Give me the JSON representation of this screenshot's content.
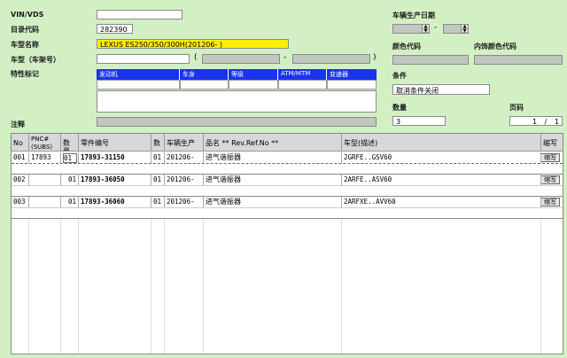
{
  "labels": {
    "vin": "VIN/VDS",
    "catalog_code": "目录代码",
    "model_name": "车型名称",
    "frame_model": "车型（车架号）",
    "features": "特性标记",
    "remarks": "注释",
    "prod_date": "车辆生产日期",
    "color_code": "颜色代码",
    "interior_color_code": "内饰颜色代码",
    "condition": "条件",
    "quantity": "数量",
    "page": "页码"
  },
  "fields": {
    "vin_value": "",
    "catalog_code_value": "282390",
    "model_name_value": "LEXUS ES250/350/300H(201206-    )",
    "condition_value": "取消条件关闭",
    "quantity_value": "3",
    "page_current": "1",
    "page_sep": "/",
    "page_total": "1",
    "date_sep": "-"
  },
  "symbols": {
    "open_paren": "(",
    "dash": "-",
    "close_paren": ")"
  },
  "feature_columns": [
    "发动机",
    "车身",
    "等级",
    "ATM/MTM",
    "变速器"
  ],
  "table": {
    "headers": {
      "no": "No",
      "pnc": "PNC#\n(SUBS)",
      "qty": "数量",
      "part_no": "零件编号",
      "count": "数",
      "prod_date": "车辆生产",
      "name": "品名 ** Rev.Ref.No **",
      "model_desc": "车型(描述)",
      "abbrev": "缩写"
    },
    "rows": [
      {
        "no": "001",
        "pnc": "17893",
        "qty": "01",
        "part_no": "17893-31150",
        "count": "01",
        "date": "201206-",
        "name": "进气谐振器",
        "model": "2GRFE..GSV60",
        "btn": "缩写"
      },
      {
        "no": "002",
        "pnc": "",
        "qty": "01",
        "part_no": "17893-36050",
        "count": "01",
        "date": "201206-",
        "name": "进气谐振器",
        "model": "2ARFE..ASV60",
        "btn": "缩写"
      },
      {
        "no": "003",
        "pnc": "",
        "qty": "01",
        "part_no": "17893-36060",
        "count": "01",
        "date": "201206-",
        "name": "进气谐振器",
        "model": "2ARFXE..AVV60",
        "btn": "缩写"
      }
    ]
  },
  "colors": {
    "background": "#d3f0c4",
    "model_highlight": "#ffee00",
    "feature_header": "#1a33ee"
  }
}
